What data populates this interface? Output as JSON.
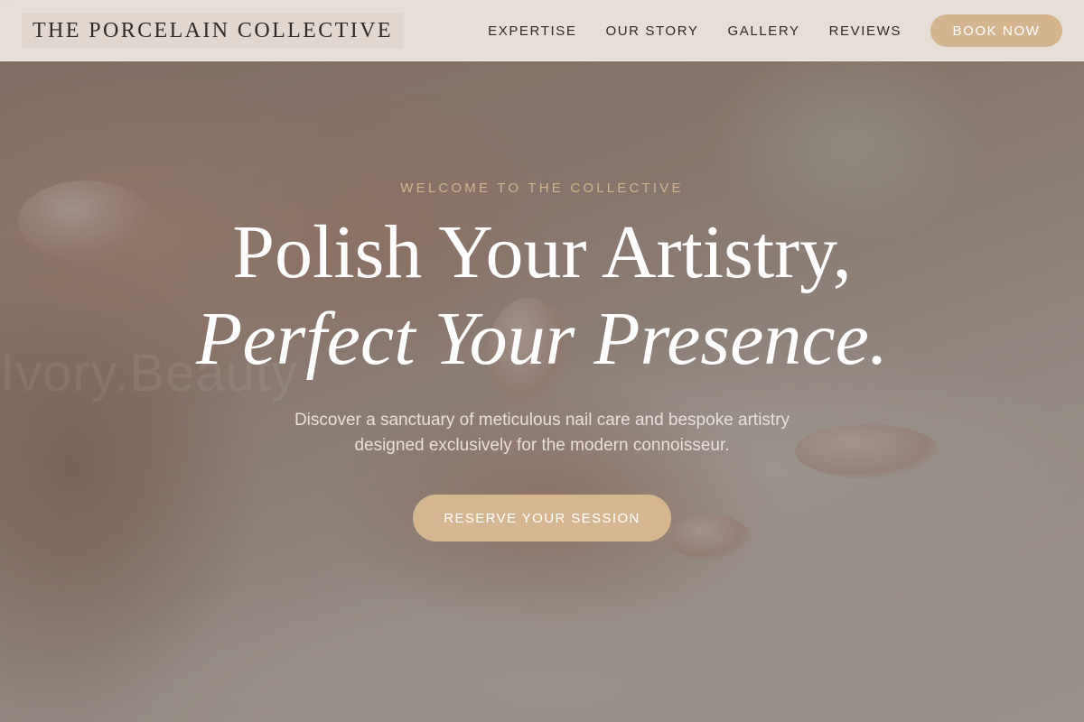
{
  "nav": {
    "brand": "THE PORCELAIN COLLECTIVE",
    "links": [
      "EXPERTISE",
      "OUR STORY",
      "GALLERY",
      "REVIEWS"
    ],
    "book_label": "BOOK NOW"
  },
  "hero": {
    "eyebrow": "WELCOME TO THE COLLECTIVE",
    "headline_line1": "Polish Your Artistry,",
    "headline_line2": "Perfect Your Presence.",
    "watermark": "Ivory.Beauty",
    "subtext_line1": "Discover a sanctuary of meticulous nail care and bespoke artistry",
    "subtext_line2": "designed exclusively for the modern connoisseur.",
    "cta_label": "RESERVE YOUR SESSION"
  },
  "colors": {
    "accent": "#d2b48f",
    "nav_background": "#eee6e0",
    "text_dark": "#2f2a27",
    "text_light": "#ffffff"
  }
}
